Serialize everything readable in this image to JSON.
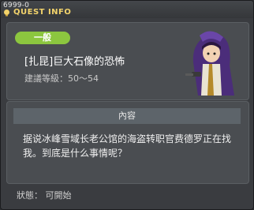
{
  "window": {
    "quest_id": "6999-0",
    "title": "QUEST INFO",
    "title_color": "#f2d36b"
  },
  "quest": {
    "tag": "一般",
    "tag_color": "#8cc63f",
    "name": "[扎昆]巨大石像的恐怖",
    "recommended_level": "建議等級：50～54",
    "portrait_icon": "hooded-thief-npc"
  },
  "content": {
    "header": "內容",
    "description": "据说冰峰雪域长老公馆的海盗转职官费德罗正在找我。到底是什么事情呢？"
  },
  "footer": {
    "status": "狀態：  可開始"
  }
}
